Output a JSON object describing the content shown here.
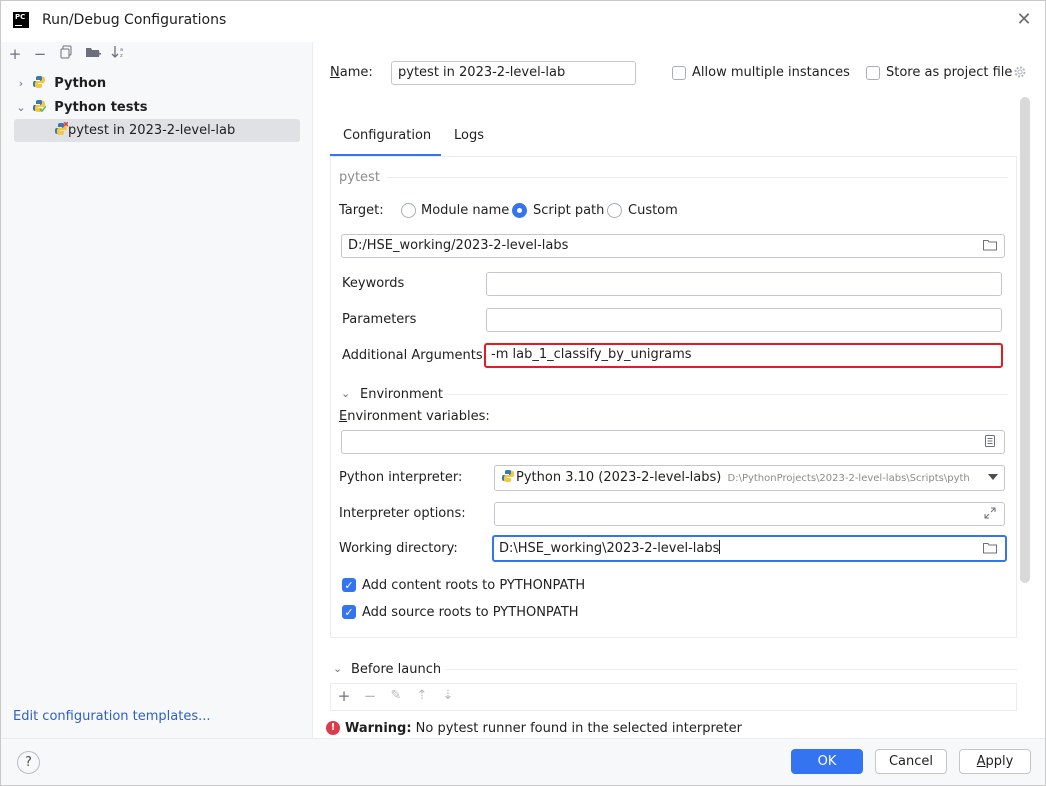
{
  "window": {
    "title": "Run/Debug Configurations",
    "app_icon_text": "PC"
  },
  "sidebar": {
    "toolbar": [
      "add-icon",
      "remove-icon",
      "copy-icon",
      "folder-icon",
      "sort-icon"
    ],
    "tree": [
      {
        "label": "Python",
        "expanded": false,
        "selected": false
      },
      {
        "label": "Python tests",
        "expanded": true,
        "selected": false
      },
      {
        "label": "pytest in 2023-2-level-lab",
        "selected": true
      }
    ],
    "edit_templates_link": "Edit configuration templates..."
  },
  "config": {
    "name_label": "Name:",
    "name_value": "pytest in 2023-2-level-lab",
    "allow_multiple_label": "Allow multiple instances",
    "allow_multiple_checked": false,
    "store_project_label": "Store as project file",
    "store_project_checked": false,
    "tabs": [
      "Configuration",
      "Logs"
    ],
    "active_tab": "Configuration",
    "section_title": "pytest",
    "target_label": "Target:",
    "target_options": [
      "Module name",
      "Script path",
      "Custom"
    ],
    "target_selected": "Script path",
    "script_path_value": "D:/HSE_working/2023-2-level-labs",
    "keywords_label": "Keywords",
    "keywords_value": "",
    "parameters_label": "Parameters",
    "parameters_value": "",
    "additional_args_label": "Additional Arguments",
    "additional_args_value": "-m lab_1_classify_by_unigrams",
    "environment_section": "Environment",
    "env_vars_label": "Environment variables:",
    "env_vars_value": "",
    "interpreter_label": "Python interpreter:",
    "interpreter_name": "Python 3.10 (2023-2-level-labs)",
    "interpreter_path": "D:\\PythonProjects\\2023-2-level-labs\\Scripts\\pyth",
    "interpreter_options_label": "Interpreter options:",
    "interpreter_options_value": "",
    "working_dir_label": "Working directory:",
    "working_dir_value": "D:\\HSE_working\\2023-2-level-labs",
    "add_content_roots_label": "Add content roots to PYTHONPATH",
    "add_content_roots_checked": true,
    "add_source_roots_label": "Add source roots to PYTHONPATH",
    "add_source_roots_checked": true,
    "before_launch_label": "Before launch",
    "before_launch_toolbar": [
      "add-icon",
      "remove-icon",
      "edit-icon",
      "move-up-icon",
      "move-down-icon"
    ]
  },
  "warning": {
    "bold": "Warning:",
    "text": "No pytest runner found in the selected interpreter"
  },
  "buttons": {
    "help": "?",
    "ok": "OK",
    "cancel": "Cancel",
    "apply": "Apply"
  },
  "colors": {
    "accent": "#3574f0",
    "highlight_border": "#e31b23",
    "warning_icon": "#db3b4b",
    "sidebar_bg": "#f7f8fa",
    "selected_row": "#dfe1e5",
    "link": "#2f5fc7"
  }
}
